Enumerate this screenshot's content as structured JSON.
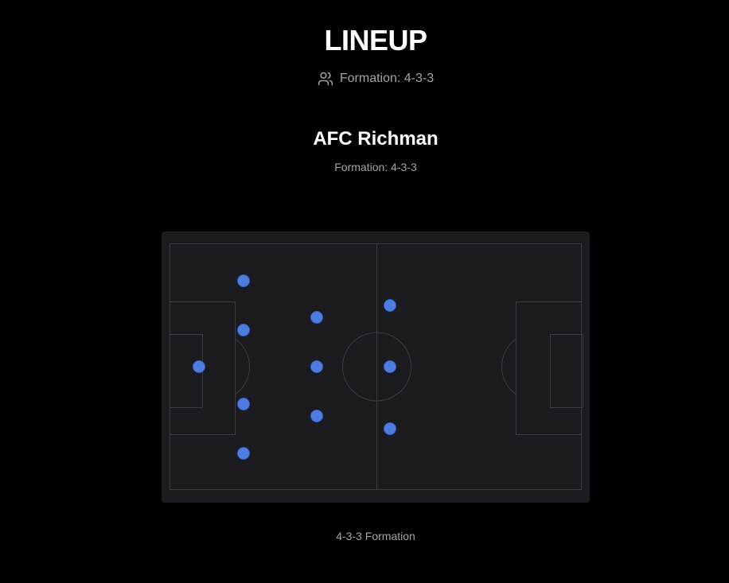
{
  "header": {
    "title": "LINEUP",
    "formation_label": "Formation: 4-3-3",
    "formation_icon": "users-icon"
  },
  "team": {
    "name": "AFC Richman",
    "formation_label": "Formation: 4-3-3"
  },
  "pitch": {
    "caption": "4-3-3 Formation",
    "colors": {
      "background": "#1c1c20",
      "lines": "#3a3a40",
      "player_fill": "#4e7ddf",
      "player_stroke": "#2f5fc4"
    },
    "players": [
      {
        "role": "GK"
      },
      {
        "role": "DEF"
      },
      {
        "role": "DEF"
      },
      {
        "role": "DEF"
      },
      {
        "role": "DEF"
      },
      {
        "role": "MID"
      },
      {
        "role": "MID"
      },
      {
        "role": "MID"
      },
      {
        "role": "FWD"
      },
      {
        "role": "FWD"
      },
      {
        "role": "FWD"
      }
    ]
  }
}
